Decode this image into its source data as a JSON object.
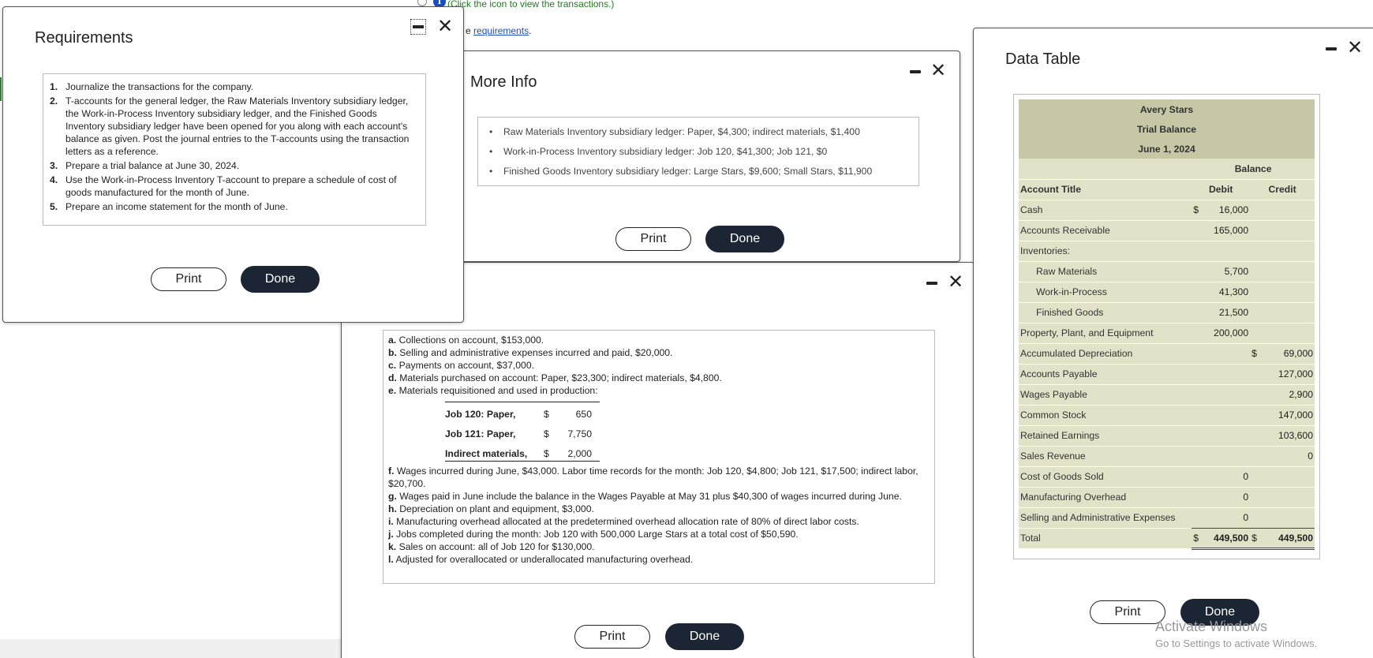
{
  "background": {
    "hint_text": "(Click the icon to view the transactions.)",
    "info_icon": "i",
    "req_prefix": "e",
    "req_link": "requirements",
    "req_suffix": "."
  },
  "requirements": {
    "title": "Requirements",
    "items": [
      {
        "num": "1.",
        "text": "Journalize the transactions for the company."
      },
      {
        "num": "2.",
        "text": "T-accounts for the general ledger, the Raw Materials Inventory subsidiary ledger, the Work-in-Process Inventory subsidiary ledger, and the Finished Goods Inventory subsidiary ledger have been opened for you along with each account's balance as given. Post the journal entries to the T-accounts using the transaction letters as a reference."
      },
      {
        "num": "3.",
        "text": "Prepare a trial balance at June 30, 2024."
      },
      {
        "num": "4.",
        "text": "Use the Work-in-Process Inventory T-account to prepare a schedule of cost of goods manufactured for the month of June."
      },
      {
        "num": "5.",
        "text": "Prepare an income statement for the month of June."
      }
    ],
    "print_label": "Print",
    "done_label": "Done"
  },
  "more_info": {
    "title": "More Info",
    "items": [
      "Raw Materials Inventory subsidiary ledger: Paper, $4,300; indirect materials, $1,400",
      "Work-in-Process Inventory subsidiary ledger: Job 120, $41,300; Job 121, $0",
      "Finished Goods Inventory subsidiary ledger: Large Stars, $9,600; Small Stars, $11,900"
    ],
    "print_label": "Print",
    "done_label": "Done"
  },
  "transactions": {
    "lines_top": [
      {
        "letter": "a.",
        "text": "Collections on account, $153,000."
      },
      {
        "letter": "b.",
        "text": "Selling and administrative expenses incurred and paid, $20,000."
      },
      {
        "letter": "c.",
        "text": "Payments on account, $37,000."
      },
      {
        "letter": "d.",
        "text": "Materials purchased on account: Paper, $23,300; indirect materials, $4,800."
      },
      {
        "letter": "e.",
        "text": "Materials requisitioned and used in production:"
      }
    ],
    "sub_rows": [
      {
        "label": "Job 120: Paper,",
        "cur": "$",
        "amount": "650"
      },
      {
        "label": "Job 121: Paper,",
        "cur": "$",
        "amount": "7,750"
      },
      {
        "label": "Indirect materials,",
        "cur": "$",
        "amount": "2,000"
      }
    ],
    "lines_bottom": [
      {
        "letter": "f.",
        "text": "Wages incurred during June, $43,000. Labor time records for the month: Job 120, $4,800; Job 121, $17,500; indirect labor, $20,700."
      },
      {
        "letter": "g.",
        "text": "Wages paid in June include the balance in the Wages Payable at May 31 plus $40,300 of wages incurred during June."
      },
      {
        "letter": "h.",
        "text": "Depreciation on plant and equipment, $3,000."
      },
      {
        "letter": "i.",
        "text": "Manufacturing overhead allocated at the predetermined overhead allocation rate of 80% of direct labor costs."
      },
      {
        "letter": "j.",
        "text": "Jobs completed during the month: Job 120 with 500,000 Large Stars at a total cost of $50,590."
      },
      {
        "letter": "k.",
        "text": "Sales on account: all of Job 120 for $130,000."
      },
      {
        "letter": "l.",
        "text": "Adjusted for overallocated or underallocated manufacturing overhead."
      }
    ],
    "print_label": "Print",
    "done_label": "Done"
  },
  "data_table": {
    "title": "Data Table",
    "company": "Avery Stars",
    "report": "Trial Balance",
    "date": "June 1, 2024",
    "balance_header": "Balance",
    "col_account": "Account Title",
    "col_debit": "Debit",
    "col_credit": "Credit",
    "rows": [
      {
        "title": "Cash",
        "indent": false,
        "dcur": "$",
        "debit": "16,000",
        "ccur": "",
        "credit": ""
      },
      {
        "title": "Accounts Receivable",
        "indent": false,
        "dcur": "",
        "debit": "165,000",
        "ccur": "",
        "credit": ""
      },
      {
        "title": "Inventories:",
        "indent": false,
        "dcur": "",
        "debit": "",
        "ccur": "",
        "credit": ""
      },
      {
        "title": "Raw Materials",
        "indent": true,
        "dcur": "",
        "debit": "5,700",
        "ccur": "",
        "credit": ""
      },
      {
        "title": "Work-in-Process",
        "indent": true,
        "dcur": "",
        "debit": "41,300",
        "ccur": "",
        "credit": ""
      },
      {
        "title": "Finished Goods",
        "indent": true,
        "dcur": "",
        "debit": "21,500",
        "ccur": "",
        "credit": ""
      },
      {
        "title": "Property, Plant, and Equipment",
        "indent": false,
        "dcur": "",
        "debit": "200,000",
        "ccur": "",
        "credit": ""
      },
      {
        "title": "Accumulated Depreciation",
        "indent": false,
        "dcur": "",
        "debit": "",
        "ccur": "$",
        "credit": "69,000"
      },
      {
        "title": "Accounts Payable",
        "indent": false,
        "dcur": "",
        "debit": "",
        "ccur": "",
        "credit": "127,000"
      },
      {
        "title": "Wages Payable",
        "indent": false,
        "dcur": "",
        "debit": "",
        "ccur": "",
        "credit": "2,900"
      },
      {
        "title": "Common Stock",
        "indent": false,
        "dcur": "",
        "debit": "",
        "ccur": "",
        "credit": "147,000"
      },
      {
        "title": "Retained Earnings",
        "indent": false,
        "dcur": "",
        "debit": "",
        "ccur": "",
        "credit": "103,600"
      },
      {
        "title": "Sales Revenue",
        "indent": false,
        "dcur": "",
        "debit": "",
        "ccur": "",
        "credit": "0"
      },
      {
        "title": "Cost of Goods Sold",
        "indent": false,
        "dcur": "",
        "debit": "0",
        "ccur": "",
        "credit": ""
      },
      {
        "title": "Manufacturing Overhead",
        "indent": false,
        "dcur": "",
        "debit": "0",
        "ccur": "",
        "credit": ""
      },
      {
        "title": "Selling and Administrative Expenses",
        "indent": false,
        "dcur": "",
        "debit": "0",
        "ccur": "",
        "credit": ""
      }
    ],
    "total": {
      "title": "Total",
      "dcur": "$",
      "debit": "449,500",
      "ccur": "$",
      "credit": "449,500"
    },
    "print_label": "Print",
    "done_label": "Done"
  },
  "watermark": {
    "line1": "Activate Windows",
    "line2": "Go to Settings to activate Windows."
  }
}
